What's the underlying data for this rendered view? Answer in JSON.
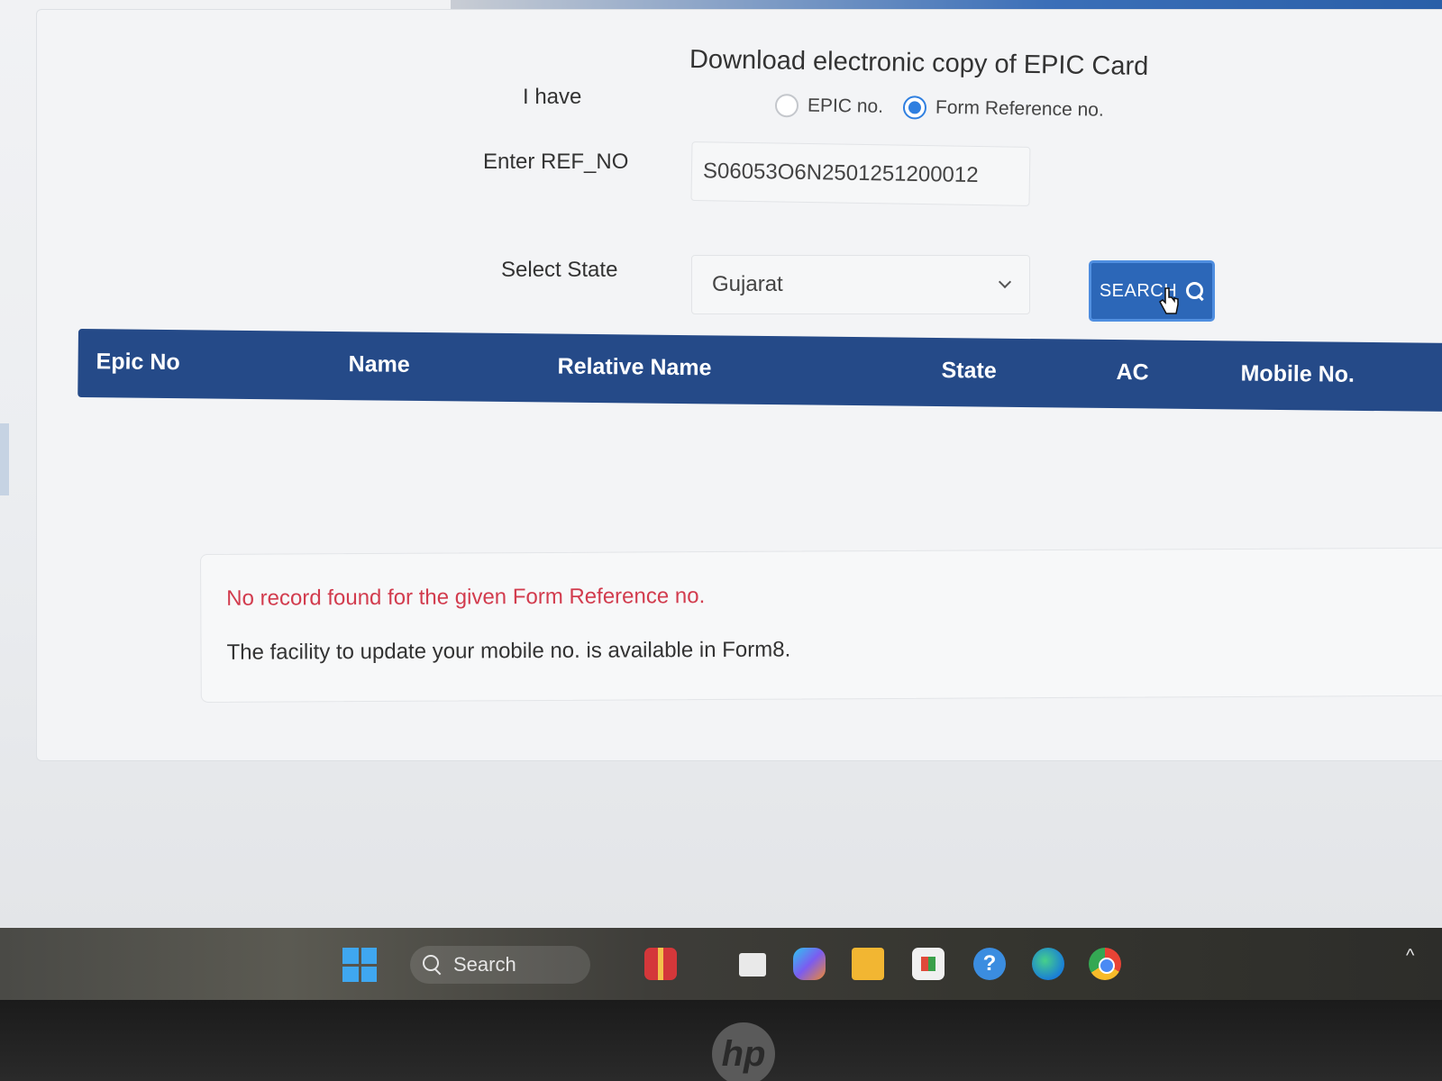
{
  "page": {
    "title": "Download electronic copy of EPIC Card"
  },
  "form": {
    "i_have_label": "I have",
    "radio_options": [
      {
        "label": "EPIC no.",
        "checked": false
      },
      {
        "label": "Form Reference no.",
        "checked": true
      }
    ],
    "ref_label": "Enter REF_NO",
    "ref_value": "S06053O6N2501251200012",
    "state_label": "Select State",
    "state_value": "Gujarat",
    "search_label": "SEARCH"
  },
  "table": {
    "columns": [
      "Epic No",
      "Name",
      "Relative Name",
      "State",
      "AC",
      "Mobile No."
    ],
    "header_color": "#254a88"
  },
  "messages": {
    "error": "No record found for the given Form Reference no.",
    "info": "The facility to update your mobile no. is available in Form8.",
    "error_color": "#d23c4e"
  },
  "taskbar": {
    "search_label": "Search",
    "icons": [
      "windows-start-icon",
      "search-icon",
      "gift-icon",
      "files-icon",
      "copilot-icon",
      "folder-icon",
      "store-icon",
      "help-icon",
      "edge-icon",
      "chrome-icon",
      "tray-chevron-icon"
    ]
  },
  "bezel": {
    "logo": "hp"
  }
}
